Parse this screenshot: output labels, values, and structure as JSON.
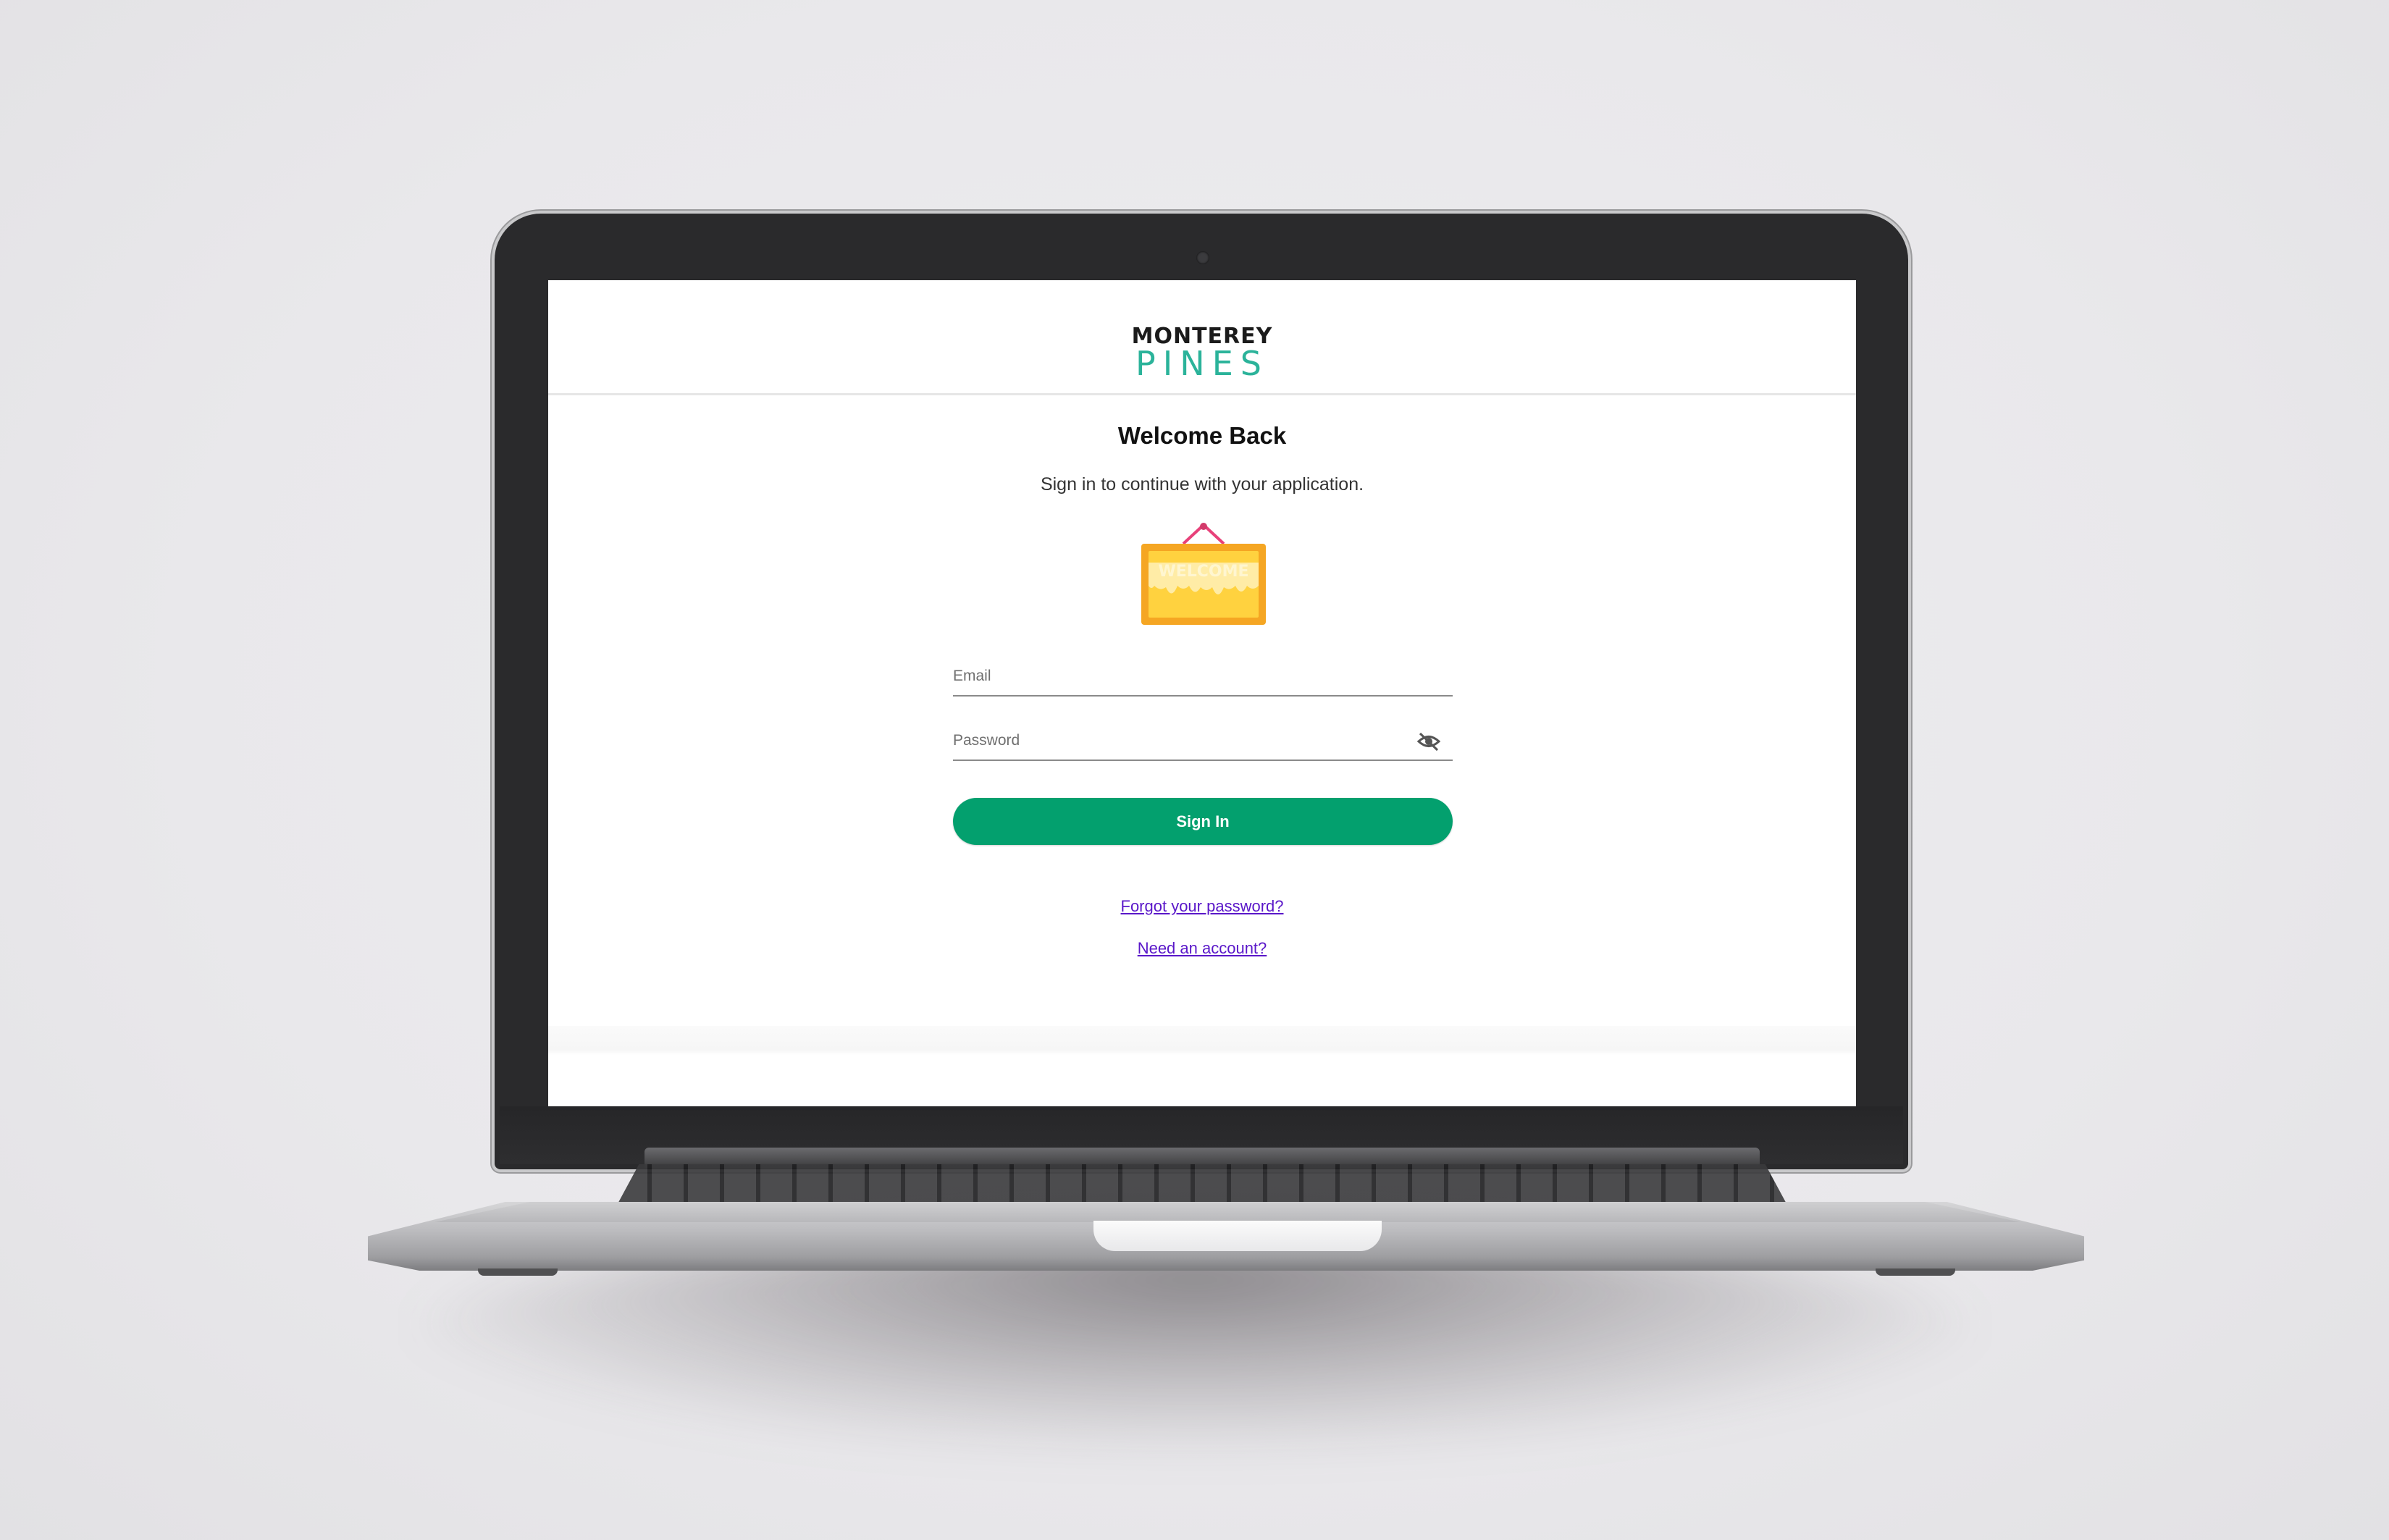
{
  "brand": {
    "line1": "MONTEREY",
    "line2": "PINES",
    "accent_color": "#2bb39a"
  },
  "login": {
    "title": "Welcome Back",
    "subtitle": "Sign in to continue with your application.",
    "illustration_text": "WELCOME",
    "email": {
      "placeholder": "Email",
      "value": ""
    },
    "password": {
      "placeholder": "Password",
      "value": "",
      "toggle_icon": "eye-off-icon"
    },
    "sign_in_label": "Sign In",
    "button_color": "#03a06e",
    "forgot_link": "Forgot your password?",
    "account_link": "Need an account?",
    "link_color": "#5a17c9"
  }
}
